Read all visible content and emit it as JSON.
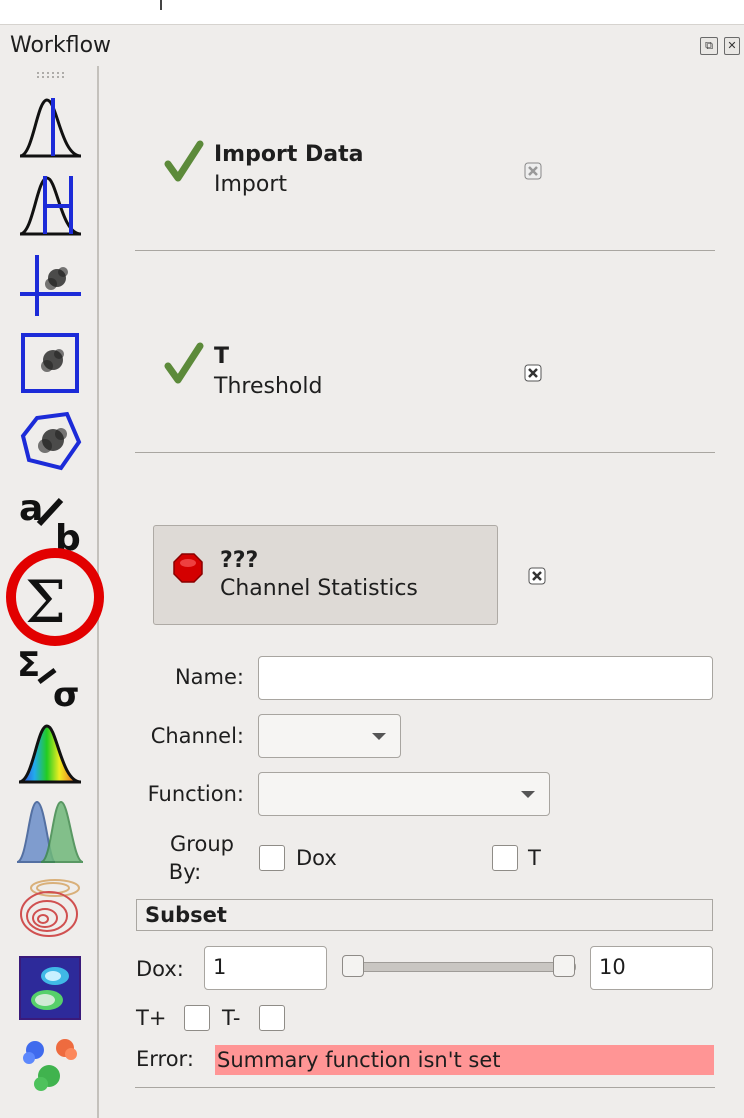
{
  "window": {
    "title": "Workflow"
  },
  "toolbar": {
    "icons": [
      "histogram-threshold-icon",
      "range-gate-icon",
      "quad-gate-icon",
      "rectangle-gate-icon",
      "polygon-gate-icon",
      "ratio-icon",
      "sigma-statistics-icon",
      "sigma-sigma-icon",
      "spectrum-histogram-icon",
      "gaussian-mixture-icon",
      "density-contour-icon",
      "image-region-icon",
      "cluster-scatter-icon"
    ],
    "highlighted": "sigma-statistics-icon"
  },
  "steps": [
    {
      "name": "Import Data",
      "type": "Import",
      "status": "ok"
    },
    {
      "name": "T",
      "type": "Threshold",
      "status": "ok"
    },
    {
      "name": "???",
      "type": "Channel Statistics",
      "status": "error"
    }
  ],
  "form": {
    "name_label": "Name:",
    "name_value": "",
    "channel_label": "Channel:",
    "channel_value": "",
    "function_label": "Function:",
    "function_value": "",
    "groupby_label_1": "Group",
    "groupby_label_2": "By:",
    "groupby_options": [
      "Dox",
      "T"
    ]
  },
  "subset": {
    "title": "Subset",
    "dox_label": "Dox:",
    "dox_min": "1",
    "dox_max": "10",
    "t_plus_label": "T+",
    "t_minus_label": "T-"
  },
  "error": {
    "label": "Error:",
    "message": "Summary function isn't set"
  },
  "colors": {
    "error_bg": "#ff9595",
    "highlight_ring": "#e20000",
    "check_green": "#5c8a3a",
    "stop_red": "#d40000"
  }
}
